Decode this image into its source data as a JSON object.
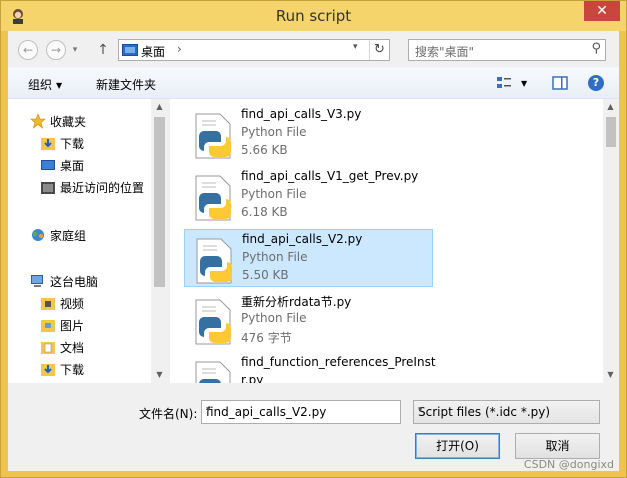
{
  "window": {
    "title": "Run script",
    "close_label": "✕"
  },
  "nav": {
    "back_glyph": "←",
    "forward_glyph": "→",
    "dropdown_glyph": "▾",
    "up_glyph": "↑",
    "address": {
      "crumb": "桌面",
      "sep": "›",
      "dropdown": "▾",
      "refresh": "↻"
    },
    "search_placeholder": "搜索\"桌面\"",
    "search_glyph": "⚲"
  },
  "toolbar": {
    "organize": "组织",
    "organize_caret": "▼",
    "new_folder": "新建文件夹",
    "view_caret": "▼",
    "help": "?"
  },
  "sidebar": {
    "items": [
      {
        "label": "收藏夹",
        "icon": "star-icon"
      },
      {
        "label": "下载",
        "icon": "download-folder-icon"
      },
      {
        "label": "桌面",
        "icon": "desktop-icon"
      },
      {
        "label": "最近访问的位置",
        "icon": "recent-places-icon"
      },
      {
        "label": "家庭组",
        "icon": "homegroup-icon"
      },
      {
        "label": "这台电脑",
        "icon": "computer-icon"
      },
      {
        "label": "视频",
        "icon": "videos-folder-icon"
      },
      {
        "label": "图片",
        "icon": "pictures-folder-icon"
      },
      {
        "label": "文档",
        "icon": "documents-folder-icon"
      },
      {
        "label": "下载",
        "icon": "download-folder-icon"
      }
    ]
  },
  "files": [
    {
      "name": "find_api_calls_V3.py",
      "type": "Python File",
      "size": "5.66 KB",
      "selected": false
    },
    {
      "name": "find_api_calls_V1_get_Prev.py",
      "type": "Python File",
      "size": "6.18 KB",
      "selected": false
    },
    {
      "name": "find_api_calls_V2.py",
      "type": "Python File",
      "size": "5.50 KB",
      "selected": true
    },
    {
      "name": "重新分析rdata节.py",
      "type": "Python File",
      "size": "476 字节",
      "selected": false
    },
    {
      "name_line1": "find_function_references_PreInst",
      "name_line2": "r.py"
    }
  ],
  "bottom": {
    "filename_label": "文件名(N):",
    "filename_value": "find_api_calls_V2.py",
    "filter_value": "Script files (*.idc *.py)",
    "open_label": "打开(O)",
    "cancel_label": "取消"
  },
  "watermark": "CSDN @dongixd",
  "scroll_glyphs": {
    "up": "▲",
    "down": "▼"
  },
  "colors": {
    "title_bar": "#f4d46b",
    "selection": "#cce8ff",
    "close": "#c9463d"
  }
}
